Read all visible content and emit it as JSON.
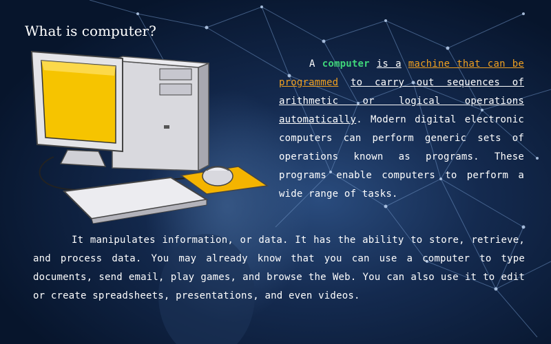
{
  "title": "What is computer?",
  "para1": {
    "p1": "A",
    "keyword": "computer",
    "u1": "is a",
    "highlight": "machine that can be programmed",
    "u2": "to carry out sequences of arithmetic or logical operations automatically",
    "rest": ". Modern digital electronic computers can perform generic sets of operations known as programs. These programs enable computers to perform a wide range of tasks."
  },
  "para2": "It manipulates information, or data. It has the ability to store, retrieve, and process data. You may already know that you can use a computer to type documents, send email, play games, and browse the Web. You can also use it to edit or create spreadsheets, presentations, and even videos.",
  "colors": {
    "background": "#0c1d3a",
    "accent_keyword": "#3fd67a",
    "accent_highlight": "#f0a020",
    "text": "#ffffff"
  },
  "icons": [
    "desktop-computer-illustration"
  ]
}
